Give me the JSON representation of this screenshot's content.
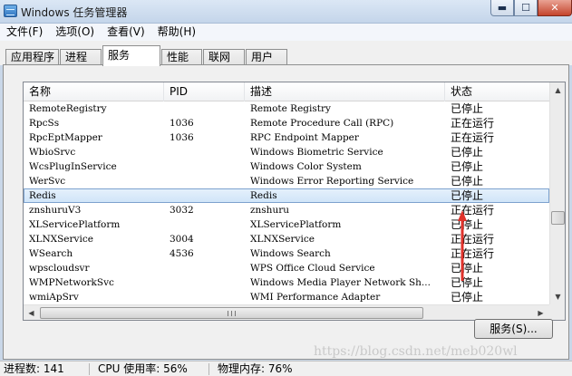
{
  "window": {
    "title": "Windows 任务管理器",
    "controls": {
      "minimize": "▬",
      "maximize": "☐",
      "close": "✕"
    }
  },
  "menu": [
    "文件(F)",
    "选项(O)",
    "查看(V)",
    "帮助(H)"
  ],
  "tabs": [
    {
      "label": "应用程序",
      "active": false
    },
    {
      "label": "进程",
      "active": false
    },
    {
      "label": "服务",
      "active": true
    },
    {
      "label": "性能",
      "active": false
    },
    {
      "label": "联网",
      "active": false
    },
    {
      "label": "用户",
      "active": false
    }
  ],
  "columns": {
    "name": "名称",
    "pid": "PID",
    "description": "描述",
    "status": "状态"
  },
  "services": [
    {
      "name": "RemoteRegistry",
      "pid": "",
      "description": "Remote Registry",
      "status": "已停止"
    },
    {
      "name": "RpcSs",
      "pid": "1036",
      "description": "Remote Procedure Call (RPC)",
      "status": "正在运行"
    },
    {
      "name": "RpcEptMapper",
      "pid": "1036",
      "description": "RPC Endpoint Mapper",
      "status": "正在运行"
    },
    {
      "name": "WbioSrvc",
      "pid": "",
      "description": "Windows Biometric Service",
      "status": "已停止"
    },
    {
      "name": "WcsPlugInService",
      "pid": "",
      "description": "Windows Color System",
      "status": "已停止"
    },
    {
      "name": "WerSvc",
      "pid": "",
      "description": "Windows Error Reporting Service",
      "status": "已停止"
    },
    {
      "name": "Redis",
      "pid": "",
      "description": "Redis",
      "status": "已停止",
      "selected": true
    },
    {
      "name": "znshuruV3",
      "pid": "3032",
      "description": "znshuru",
      "status": "正在运行"
    },
    {
      "name": "XLServicePlatform",
      "pid": "",
      "description": "XLServicePlatform",
      "status": "已停止"
    },
    {
      "name": "XLNXService",
      "pid": "3004",
      "description": "XLNXService",
      "status": "正在运行"
    },
    {
      "name": "WSearch",
      "pid": "4536",
      "description": "Windows Search",
      "status": "正在运行"
    },
    {
      "name": "wpscloudsvr",
      "pid": "",
      "description": "WPS Office Cloud Service",
      "status": "已停止"
    },
    {
      "name": "WMPNetworkSvc",
      "pid": "",
      "description": "Windows Media Player Network Sh...",
      "status": "已停止"
    },
    {
      "name": "wmiApSrv",
      "pid": "",
      "description": "WMI Performance Adapter",
      "status": "已停止"
    }
  ],
  "services_button": "服务(S)...",
  "statusbar": {
    "processes": "进程数: 141",
    "cpu": "CPU 使用率: 56%",
    "memory": "物理内存: 76%"
  },
  "watermark": "https://blog.csdn.net/meb020wl",
  "colors": {
    "annotation_arrow": "#e0322b",
    "selection": "#cfe4f8"
  }
}
